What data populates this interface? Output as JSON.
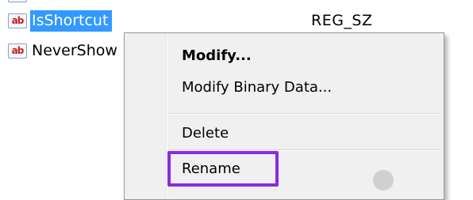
{
  "list": {
    "rows": [
      {
        "icon": "ab",
        "name": "IsShortcut",
        "type": "REG_SZ"
      },
      {
        "icon": "ab",
        "name": "NeverShow"
      }
    ]
  },
  "context_menu": {
    "items": [
      "Modify...",
      "Modify Binary Data...",
      "Delete",
      "Rename"
    ]
  }
}
